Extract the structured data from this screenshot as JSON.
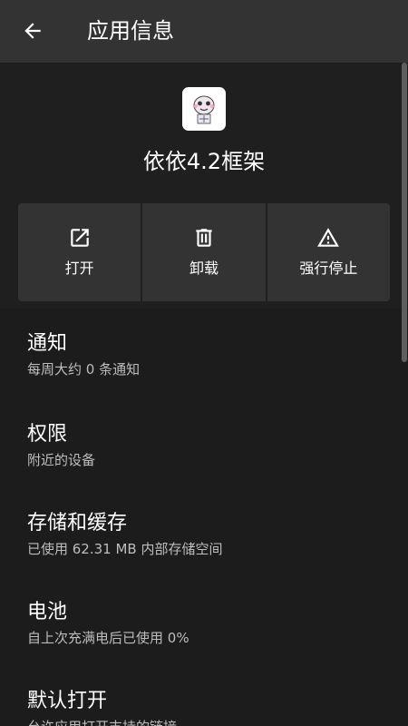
{
  "appbar": {
    "back_icon": "arrow-back-icon",
    "title": "应用信息"
  },
  "app": {
    "icon": "app-avatar-icon",
    "name": "依依4.2框架"
  },
  "actions": [
    {
      "icon": "open-in-new-icon",
      "label": "打开"
    },
    {
      "icon": "trash-icon",
      "label": "卸载"
    },
    {
      "icon": "warning-icon",
      "label": "强行停止"
    }
  ],
  "settings": [
    {
      "title": "通知",
      "subtitle": "每周大约 0 条通知"
    },
    {
      "title": "权限",
      "subtitle": "附近的设备"
    },
    {
      "title": "存储和缓存",
      "subtitle": "已使用 62.31 MB 内部存储空间"
    },
    {
      "title": "电池",
      "subtitle": "自上次充满电后已使用 0%"
    },
    {
      "title": "默认打开",
      "subtitle": "允许应用打开支持的链接"
    }
  ],
  "colors": {
    "background": "#1c1c1c",
    "appbar": "#333333",
    "tile": "#333333",
    "subtitle": "#bdbdbd"
  }
}
